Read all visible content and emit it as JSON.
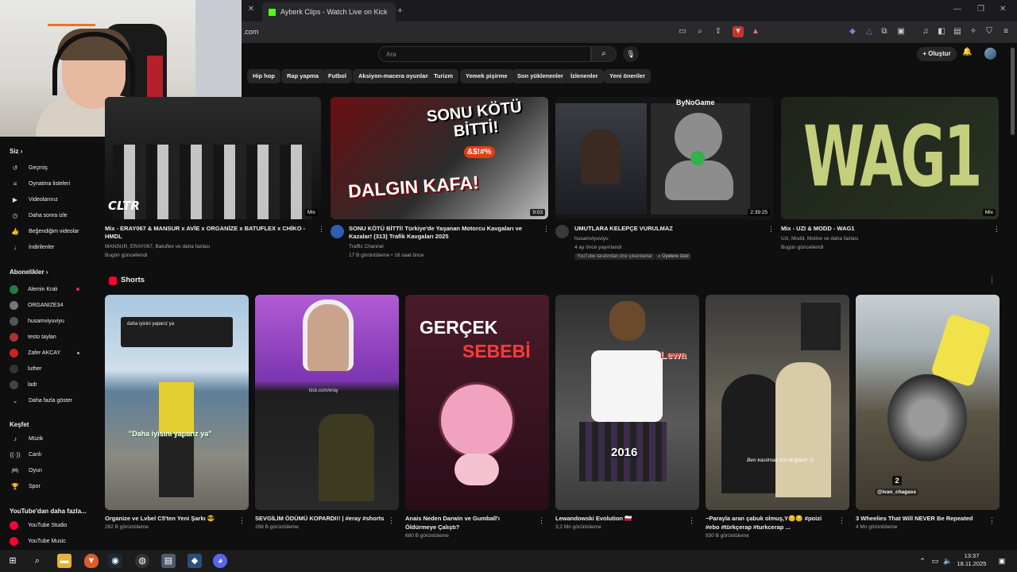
{
  "browser": {
    "tab_title": "Ayberk Clips - Watch Live on Kick",
    "url": ".com"
  },
  "header": {
    "search_placeholder": "Ara",
    "create_label": "Oluştur"
  },
  "chips": [
    "Hip hop",
    "Rap yapma",
    "Futbol",
    "Aksiyon-macera oyunları",
    "Turizm",
    "Yemek pişirme",
    "Son yüklenenler",
    "İzlenenler",
    "Yeni öneriler"
  ],
  "sidebar": {
    "you_label": "Siz",
    "you_items": [
      "Geçmiş",
      "Oynatma listeleri",
      "Videolarınız",
      "Daha sonra izle",
      "Beğendiğim videolar",
      "İndirilenler"
    ],
    "subs_label": "Abonelikler",
    "subs_items": [
      "Alemin Kralı",
      "ORGANIZE34",
      "husamviyuviyu",
      "testo taylan",
      "Zafer AKCAY",
      "luther",
      "ladr",
      "Daha fazla göster"
    ],
    "explore_label": "Keşfet",
    "explore_items": [
      "Müzik",
      "Canlı",
      "Oyun",
      "Spor"
    ],
    "more_label": "YouTube'dan daha fazla...",
    "more_items": [
      "YouTube Studio",
      "YouTube Music"
    ]
  },
  "videos": [
    {
      "title": "Mix - ERAY067 & MANSUR x AVİE x ORGANİZE x BATUFLEX x CHİKO - HMDL",
      "meta1": "MANSUR, ERAY067, Batuflex ve daha fazlası",
      "meta2": "Bugün güncellendi",
      "badge": "Mix",
      "overlay": "CLTR"
    },
    {
      "title": "SONU KÖTÜ BİTTİ! Türkiye'de Yaşanan Motorcu Kavgaları ve Kazalar! (313) Trafik Kavgaları 2025",
      "meta1": "Traffic Channel",
      "meta2": "17 B görüntüleme • 18 saat önce",
      "badge": "9:03",
      "overlay1": "SONU KÖTÜ BİTTİ!",
      "overlay2": "DALGIN KAFA!",
      "overlay3": "&$!#%"
    },
    {
      "title": "UMUTLARA KELEPÇE VURULMAZ",
      "meta1": "husamviyuviyu",
      "meta2": "4 ay önce yayınlandı",
      "badge": "2:39:25",
      "overlay": "ByNoGame",
      "pill1": "YouTube tarafından öne çıkarılanlar",
      "pill2": "Üyelere özel"
    },
    {
      "title": "Mix - UZI & MODD - WAG1",
      "meta1": "Uzi, Modd, Motive ve daha fazlası",
      "meta2": "Bugün güncellendi",
      "badge": "Mix",
      "overlay": "WAG1"
    }
  ],
  "shorts": {
    "label": "Shorts",
    "items": [
      {
        "title": "Organize ve Lvbel C5'ten Yeni Şarkı 😎",
        "views": "262 B görüntüleme",
        "overlay": "\"Daha iyisini yaparız ya\"",
        "comment": "daha iyisini yaparız ya"
      },
      {
        "title": "SEVGİLİM ÖDÜMÜ KOPARDI!! | #eray #shorts",
        "views": "288 B görüntüleme",
        "overlay": "kick.com/eray"
      },
      {
        "title": "Anais Neden Darwin ve Gumball'ı Öldürmeye Çalıştı?",
        "views": "680 B görüntüleme",
        "overlay1": "GERÇEK",
        "overlay2": "SEBEBİ"
      },
      {
        "title": "Lewandowski Evolution 🇵🇱",
        "views": "3,2 Mn görüntüleme",
        "overlay1": "Lewa",
        "overlay2": "2016"
      },
      {
        "title": "~Parayla aran çabuk olmuş,Y😔😔 #poizi #ebo #türkçerap #turkcerap ...",
        "views": "930 B görüntüleme",
        "overlay": "Ben kasılmak için doğdum :D"
      },
      {
        "title": "3 Wheelies That Will NEVER Be Repeated",
        "views": "4 Mn görüntüleme",
        "overlay": "@ivan_chagass",
        "num": "2"
      }
    ]
  },
  "taskbar": {
    "time": "13:37",
    "date": "18.11.2025"
  },
  "colors": {
    "accent_red": "#ff0033",
    "kick_green": "#53fc18",
    "bg": "#0f0f0f"
  }
}
